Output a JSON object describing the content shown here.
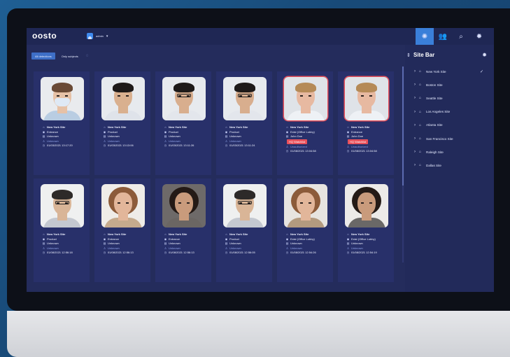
{
  "app": {
    "logo": "oosto",
    "user": "admin"
  },
  "nav": {
    "icons": [
      "settings-active-icon",
      "people-icon",
      "search-icon",
      "gear-icon"
    ]
  },
  "filters": {
    "all_detections": "All detections",
    "only_subjects": "Only subjects"
  },
  "cards": [
    {
      "site": "New York Site",
      "camera": "Entrance",
      "name": "Unknown",
      "status": "Unknown",
      "time": "01/03/2021 13:17:20",
      "alert": false,
      "tag": ""
    },
    {
      "site": "New York Site",
      "camera": "Product",
      "name": "Unknown",
      "status": "Unknown",
      "time": "01/03/2021 13:13:06",
      "alert": false,
      "tag": ""
    },
    {
      "site": "New York Site",
      "camera": "Product",
      "name": "Unknown",
      "status": "Unknown",
      "time": "01/03/2021 13:11:26",
      "alert": false,
      "tag": ""
    },
    {
      "site": "New York Site",
      "camera": "Product",
      "name": "Unknown",
      "status": "Unknown",
      "time": "01/03/2021 13:11:24",
      "alert": false,
      "tag": ""
    },
    {
      "site": "New York Site",
      "camera": "Exist (Office Lobby)",
      "name": "John Doe",
      "status": "Unauthorized",
      "time": "01/08/2021 13:04:58",
      "alert": true,
      "tag": "HQ Watchlist"
    },
    {
      "site": "New York Site",
      "camera": "Entrance",
      "name": "John Doe",
      "status": "Unauthorized",
      "time": "01/08/2021 13:04:58",
      "alert": true,
      "tag": "HQ Watchlist"
    },
    {
      "site": "New York Site",
      "camera": "Product",
      "name": "Unknown",
      "status": "Unknown",
      "time": "01/08/2021 12:56:18",
      "alert": false,
      "tag": ""
    },
    {
      "site": "New York Site",
      "camera": "Entrance",
      "name": "Unknown",
      "status": "Unknown",
      "time": "01/08/2021 12:56:13",
      "alert": false,
      "tag": ""
    },
    {
      "site": "New York Site",
      "camera": "Entrance",
      "name": "Unknown",
      "status": "Unknown",
      "time": "01/08/2021 12:56:13",
      "alert": false,
      "tag": ""
    },
    {
      "site": "New York Site",
      "camera": "Product",
      "name": "Unknown",
      "status": "Unknown",
      "time": "01/08/2021 12:56:05",
      "alert": false,
      "tag": ""
    },
    {
      "site": "New York Site",
      "camera": "Exist (Office Lobby)",
      "name": "Unknown",
      "status": "Unknown",
      "time": "01/08/2021 12:54:26",
      "alert": false,
      "tag": ""
    },
    {
      "site": "New York Site",
      "camera": "Exist (Office Lobby)",
      "name": "Unknown",
      "status": "Unknown",
      "time": "01/08/2021 12:54:19",
      "alert": false,
      "tag": ""
    }
  ],
  "sidebar": {
    "title": "Site Bar",
    "sites": [
      {
        "label": "New York Site",
        "checked": true
      },
      {
        "label": "Boston Site",
        "checked": false
      },
      {
        "label": "Seattle Site",
        "checked": false
      },
      {
        "label": "Los Angeles Site",
        "checked": false
      },
      {
        "label": "Atlanta Site",
        "checked": false
      },
      {
        "label": "San Francisco Site",
        "checked": false
      },
      {
        "label": "Raleigh Site",
        "checked": false
      },
      {
        "label": "Dallas Site",
        "checked": false
      }
    ]
  },
  "colors": {
    "accent": "#3a7fd9",
    "alert": "#e8505b",
    "screen_bg": "#242c5c",
    "card_bg": "#28306a"
  }
}
